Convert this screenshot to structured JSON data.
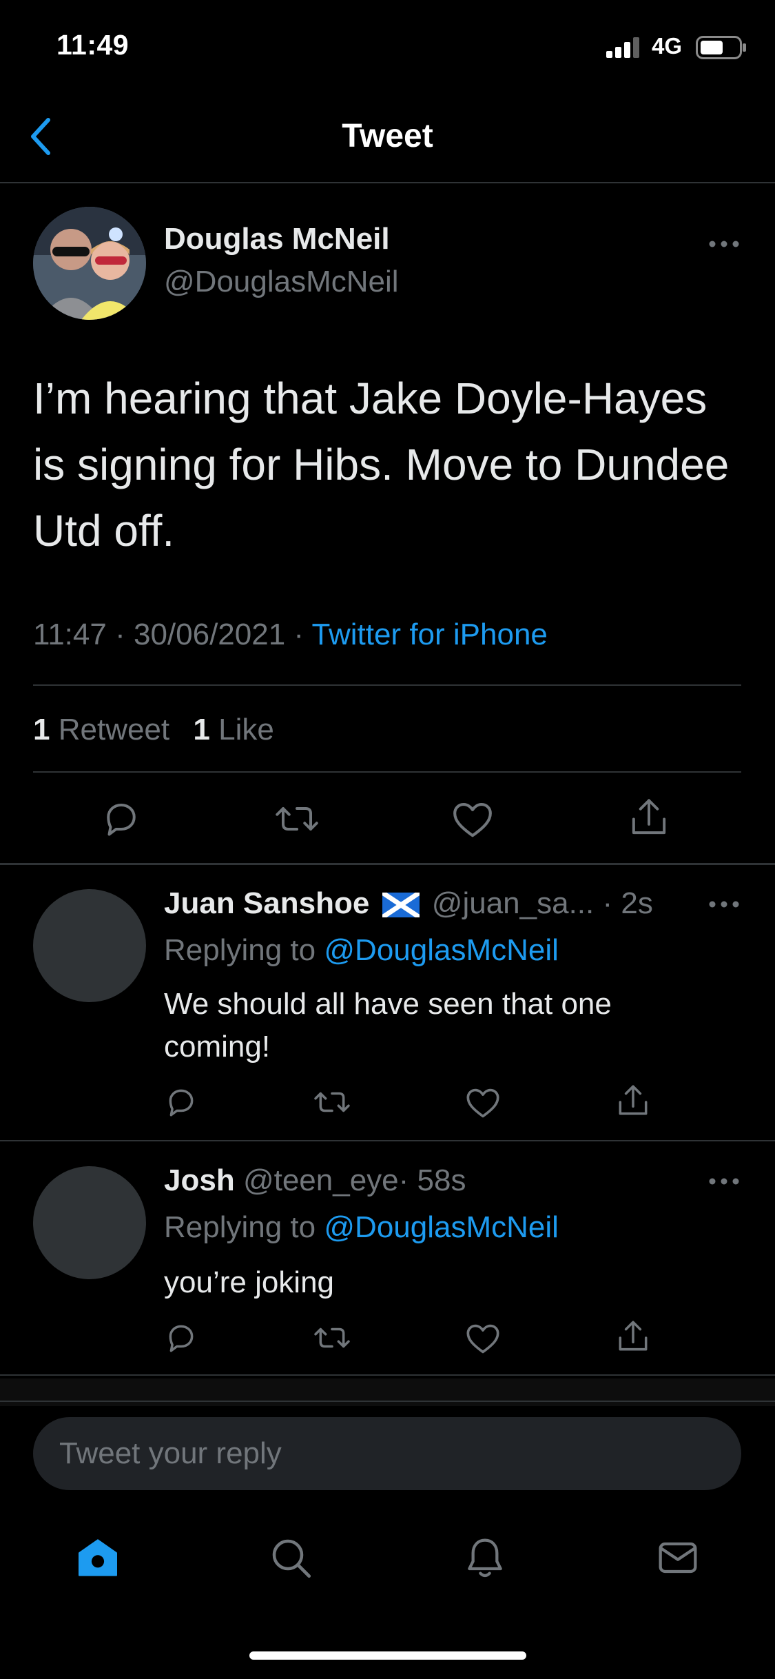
{
  "status_bar": {
    "time": "11:49",
    "network": "4G"
  },
  "nav": {
    "title": "Tweet",
    "back_icon": "chevron-left-icon"
  },
  "tweet": {
    "author_name": "Douglas McNeil",
    "author_handle": "@DouglasMcNeil",
    "text": "I’m hearing that Jake Doyle-Hayes is signing for Hibs. Move to Dundee Utd off.",
    "time": "11:47",
    "date": "30/06/2021",
    "separator": "·",
    "source": "Twitter for iPhone",
    "retweet_count": "1",
    "retweet_label": "Retweet",
    "like_count": "1",
    "like_label": "Like"
  },
  "replies": [
    {
      "name": "Juan Sanshoe",
      "handle": "@juan_sa...",
      "time": "· 2s",
      "replying_label": "Replying to",
      "replying_to": "@DouglasMcNeil",
      "text": "We should all have seen that one coming!"
    },
    {
      "name": "Josh",
      "handle": "@teen_eye",
      "time": "· 58s",
      "replying_label": "Replying to",
      "replying_to": "@DouglasMcNeil",
      "text": "you’re joking"
    }
  ],
  "composer": {
    "placeholder": "Tweet your reply"
  },
  "colors": {
    "accent": "#1d9bf0",
    "background": "#000000",
    "muted": "#71767b",
    "divider": "#2f3336"
  }
}
